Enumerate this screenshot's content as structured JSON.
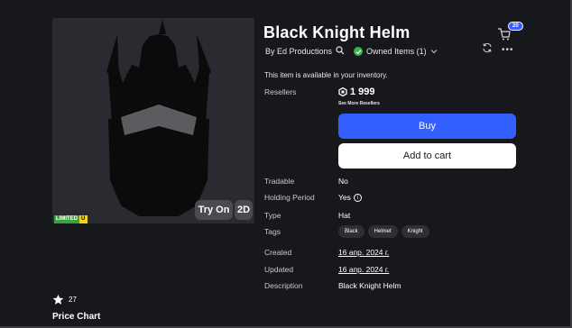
{
  "item": {
    "title": "Black Knight Helm",
    "by": "By Ed Productions",
    "owned": "Owned Items (1)",
    "available_text": "This item is available in your inventory."
  },
  "cart": {
    "count": "20"
  },
  "resellers": {
    "label": "Resellers",
    "price": "1 999",
    "see_more": "See More Resellers"
  },
  "buttons": {
    "buy": "Buy",
    "add_to_cart": "Add to cart",
    "try_on": "Try On",
    "view_2d": "2D"
  },
  "badge": {
    "limited": "LIMITED",
    "u": "U"
  },
  "details": {
    "tradable_label": "Tradable",
    "tradable_value": "No",
    "holding_label": "Holding Period",
    "holding_value": "Yes",
    "type_label": "Type",
    "type_value": "Hat",
    "tags_label": "Tags",
    "tags": [
      "Black",
      "Helmet",
      "Knight"
    ],
    "created_label": "Created",
    "created_value": "16 апр. 2024 г.",
    "updated_label": "Updated",
    "updated_value": "16 апр. 2024 г.",
    "description_label": "Description",
    "description_value": "Black Knight Helm"
  },
  "favorites": {
    "count": "27"
  },
  "price_chart": {
    "label": "Price Chart"
  },
  "icons": [
    "search-icon",
    "check-circle-icon",
    "chevron-down-icon",
    "cart-icon",
    "refresh-icon",
    "more-icon",
    "robux-icon",
    "info-icon",
    "star-icon"
  ],
  "colors": {
    "accent": "#335fff",
    "background": "#17181c",
    "owned_green": "#39b54a",
    "limited_green": "#39a43c",
    "limited_yellow": "#f4d11a"
  }
}
